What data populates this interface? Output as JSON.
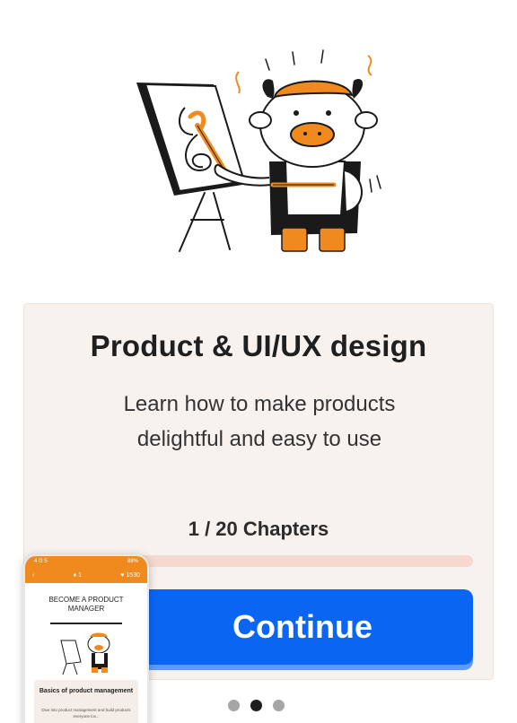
{
  "illustration": {
    "name": "cow-painter-illustration"
  },
  "course": {
    "title": "Product & UI/UX design",
    "description": "Learn how to make products delightful and easy to use",
    "chapters_label": "1 / 20 Chapters",
    "progress": {
      "current": 1,
      "total": 20
    },
    "continue_label": "Continue"
  },
  "pager": {
    "pages": 3,
    "active_index": 1
  },
  "phone_preview": {
    "status_left": "4 G 5",
    "status_right": "88%",
    "appbar_right": "1530",
    "appbar_icons": [
      "back-icon",
      "flame-icon",
      "heart-icon"
    ],
    "heading": "BECOME A PRODUCT MANAGER",
    "card_title": "Basics of product management",
    "card_desc": "Dive into product management and build products everyone lov..."
  },
  "colors": {
    "accent_orange": "#f08a1f",
    "primary_blue": "#0a66f2",
    "card_bg": "#f8f2ee",
    "progress_track": "#f5d9cf"
  }
}
